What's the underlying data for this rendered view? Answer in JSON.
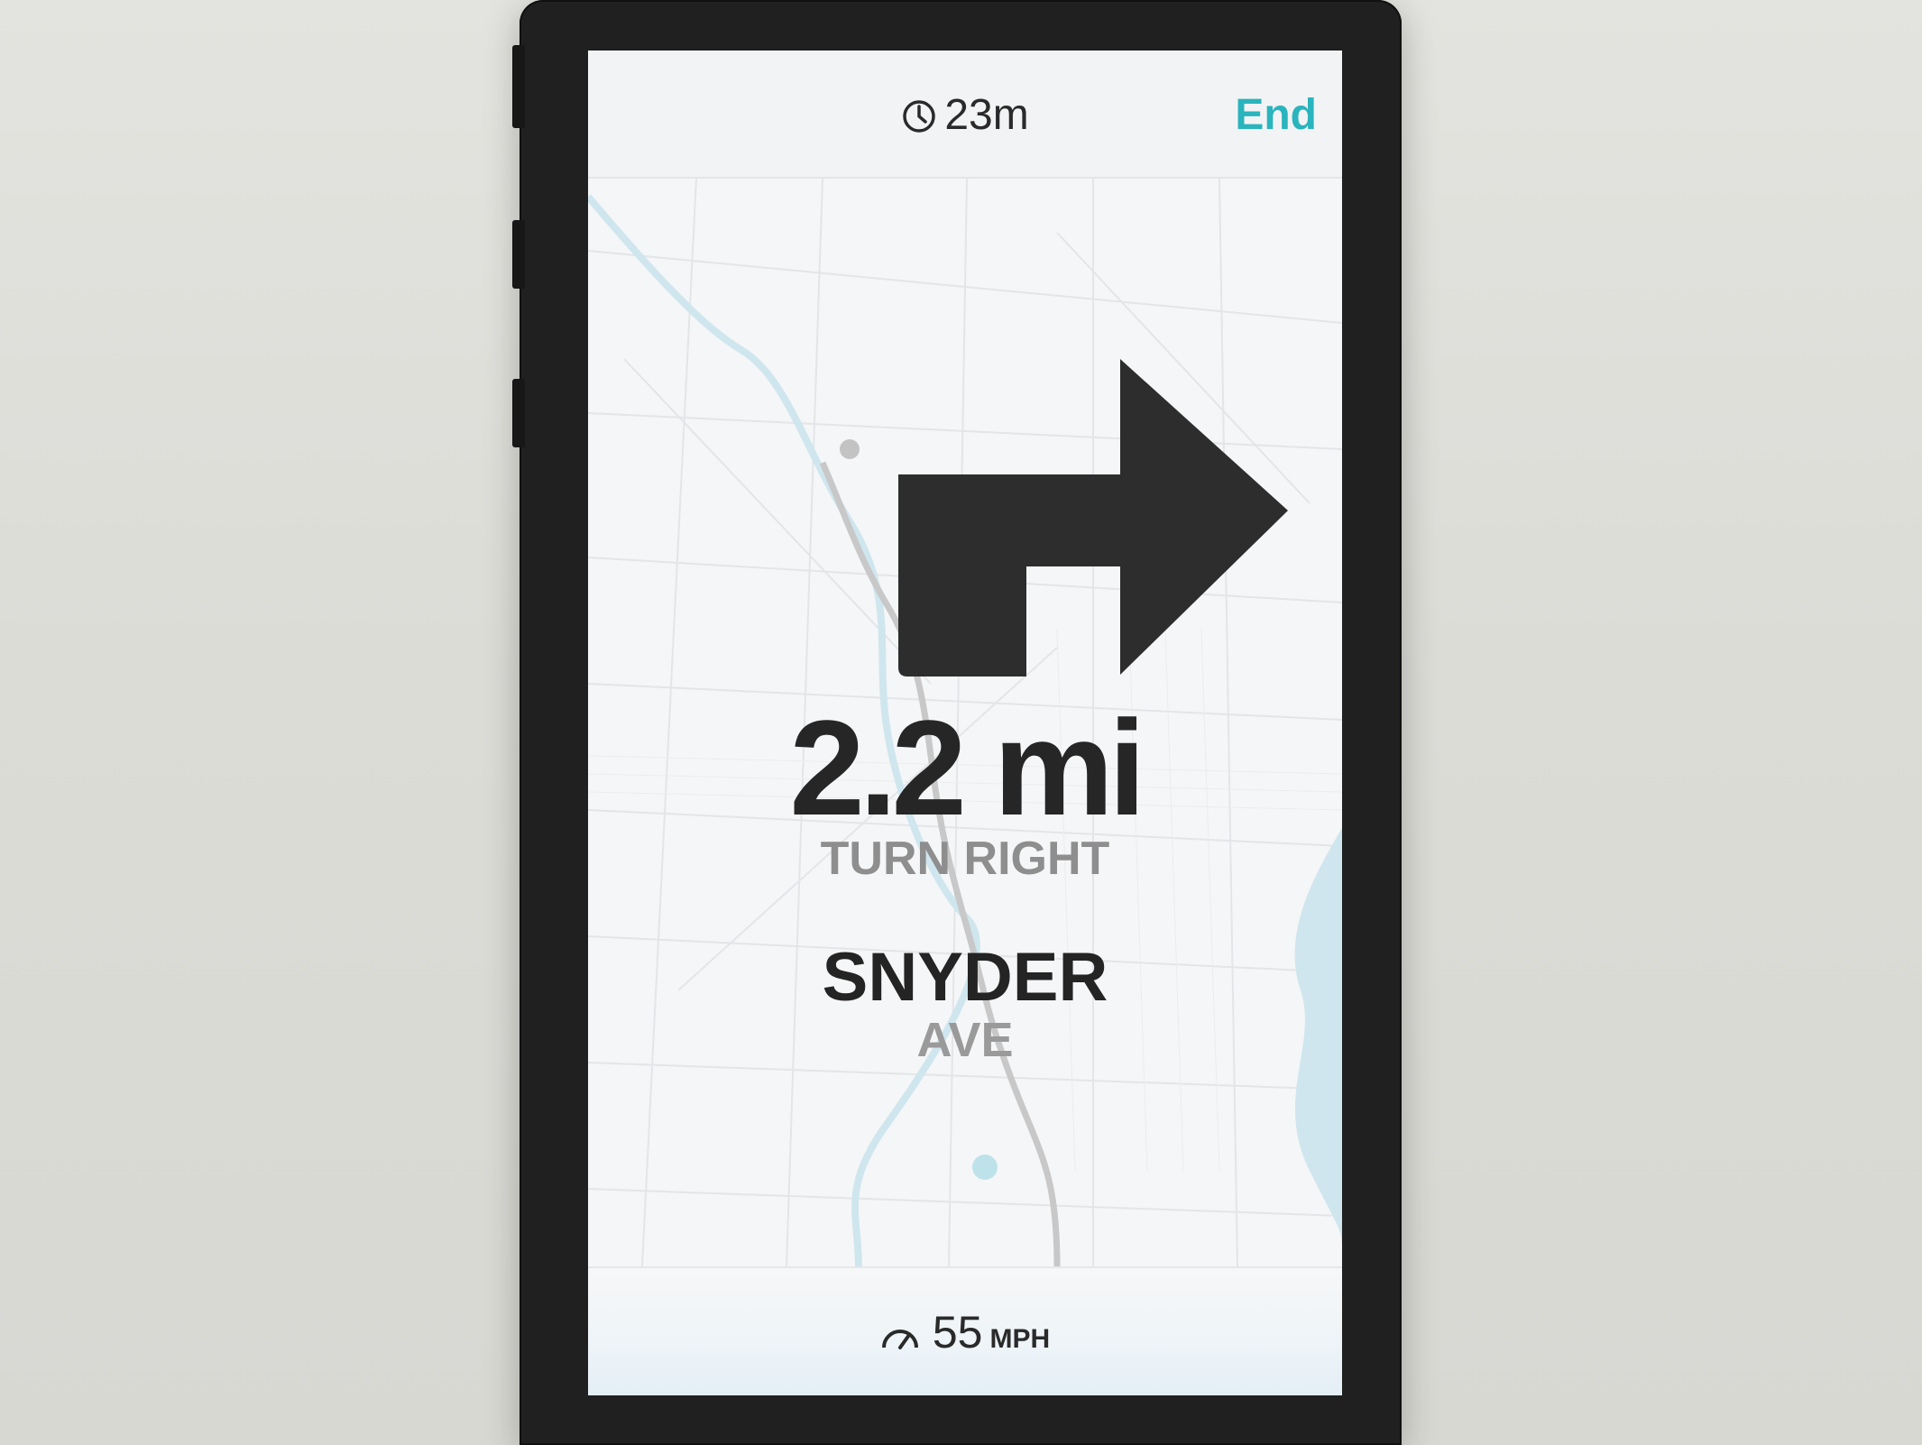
{
  "header": {
    "eta": "23m",
    "end_label": "End"
  },
  "icons": {
    "clock": "clock-icon",
    "turn": "turn-right-arrow-icon",
    "speed": "speedometer-icon"
  },
  "navigation": {
    "distance": "2.2 mi",
    "maneuver": "TURN RIGHT",
    "street_name": "SNYDER",
    "street_suffix": "AVE"
  },
  "footer": {
    "speed_value": "55",
    "speed_unit": "MPH"
  },
  "colors": {
    "accent": "#2ab4bd",
    "arrow": "#2d2d2d",
    "water": "#bfe3ec",
    "route": "#a9a9a9"
  }
}
